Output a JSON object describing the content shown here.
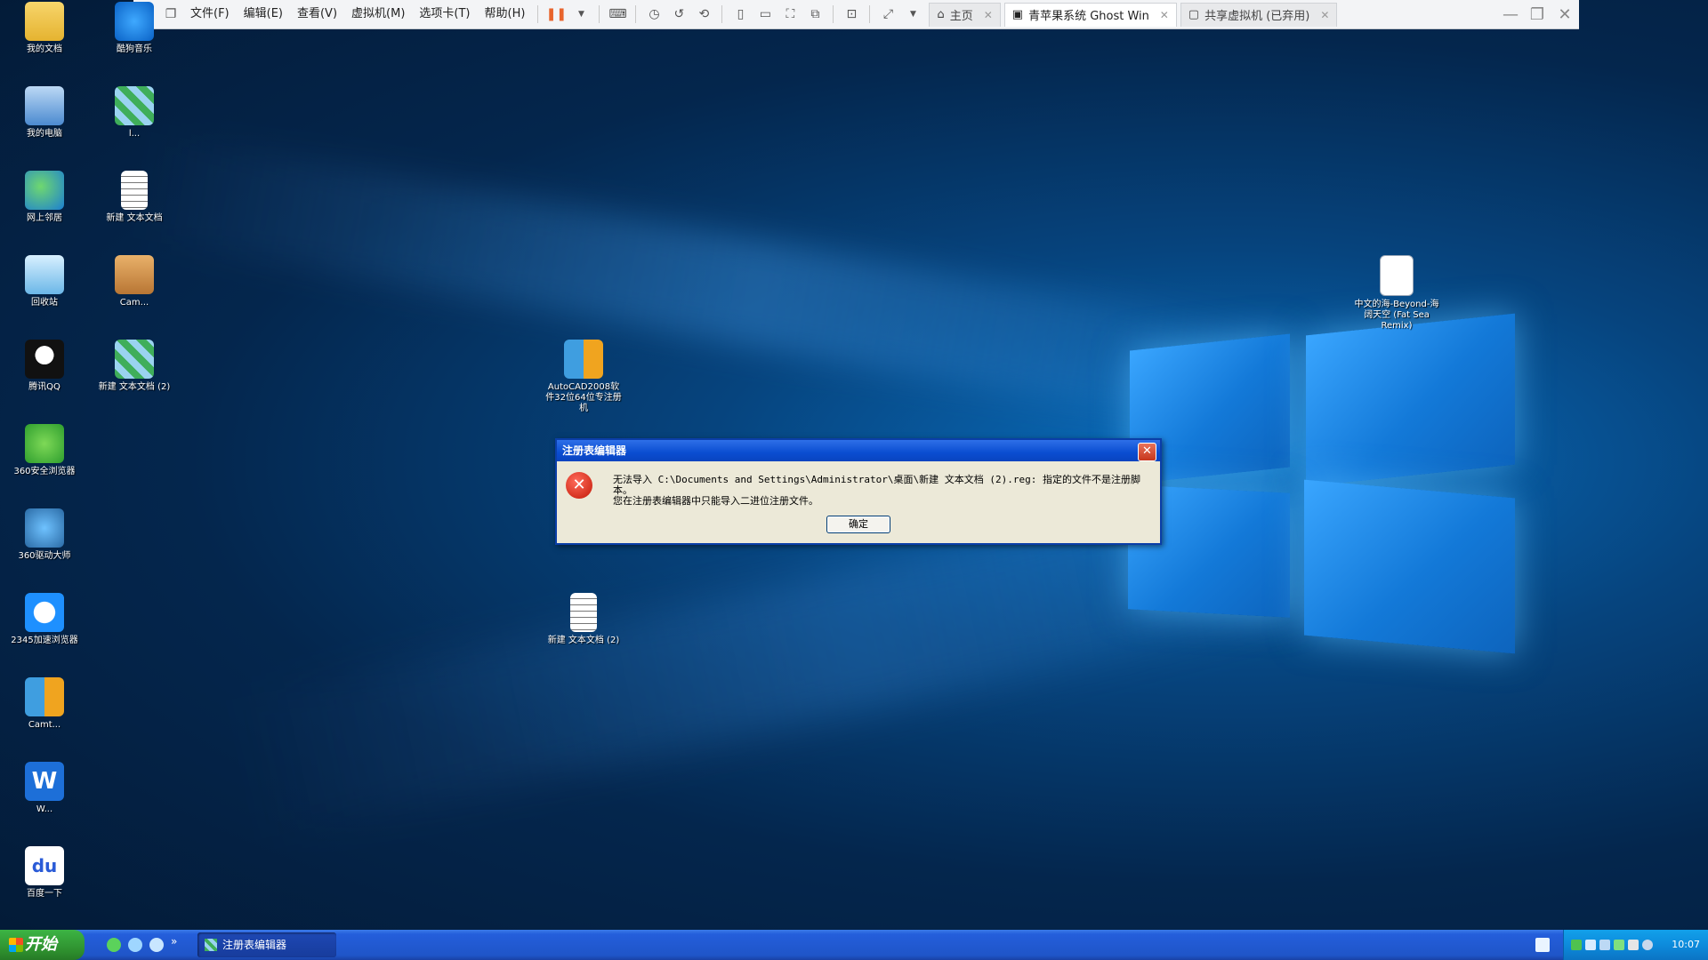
{
  "vm_toolbar": {
    "menus": [
      "文件(F)",
      "编辑(E)",
      "查看(V)",
      "虚拟机(M)",
      "选项卡(T)",
      "帮助(H)"
    ],
    "tabs": [
      {
        "label": "主页",
        "active": false
      },
      {
        "label": "青苹果系统 Ghost WinXP ...",
        "active": true
      },
      {
        "label": "共享虚拟机 (已弃用)",
        "active": false
      }
    ]
  },
  "desktop_icons": [
    {
      "label": "我的文档"
    },
    {
      "label": "我的电脑"
    },
    {
      "label": "网上邻居"
    },
    {
      "label": "回收站"
    },
    {
      "label": "腾讯QQ"
    },
    {
      "label": "360安全浏览器"
    },
    {
      "label": "360驱动大师"
    },
    {
      "label": "2345加速浏览器"
    },
    {
      "label": "Camt..."
    },
    {
      "label": "W..."
    },
    {
      "label": "百度一下"
    },
    {
      "label": "酷狗音乐"
    },
    {
      "label": "l..."
    },
    {
      "label": "新建 文本文档"
    },
    {
      "label": "Cam..."
    },
    {
      "label": "新建 文本文档 (2)"
    },
    {
      "label": "AutoCAD2008软件32位64位专注册机"
    },
    {
      "label": "新建 文本文档 (2)"
    },
    {
      "label": "中文的海-Beyond-海阔天空 (Fat Sea Remix)"
    }
  ],
  "dialog": {
    "title": "注册表编辑器",
    "message_line1": "无法导入 C:\\Documents and Settings\\Administrator\\桌面\\新建 文本文档 (2).reg: 指定的文件不是注册脚本。",
    "message_line2": "您在注册表编辑器中只能导入二进位注册文件。",
    "ok_label": "确定"
  },
  "taskbar": {
    "start_label": "开始",
    "task_button_label": "注册表编辑器",
    "clock": "10:07"
  },
  "icons": {
    "error": "x-circle-icon",
    "close": "close-icon"
  },
  "colors": {
    "desktop_bg": "#04264d",
    "taskbar": "#245edb",
    "start_green": "#2e8f2e",
    "dialog_title": "#0a4dd1"
  }
}
